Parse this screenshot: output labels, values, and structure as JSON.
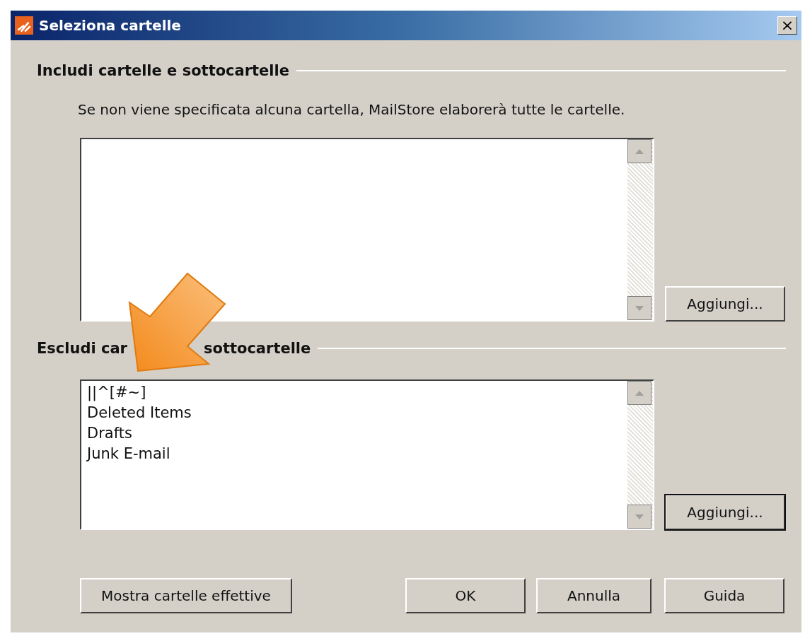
{
  "window": {
    "title": "Seleziona cartelle",
    "close": "×"
  },
  "include": {
    "heading": "Includi cartelle e sottocartelle",
    "note": "Se non viene specificata alcuna cartella, MailStore elaborerà tutte le cartelle.",
    "button": {
      "label": "Aggiungi...",
      "default": false
    }
  },
  "exclude": {
    "heading_parts": [
      "Escludi car",
      "sottocartelle"
    ],
    "items": [
      "||^[#~]",
      "Deleted Items",
      "Drafts",
      "Junk E-mail"
    ],
    "button": {
      "label": "Aggiungi...",
      "default": true
    }
  },
  "footer_buttons": [
    {
      "label": "Mostra cartelle effettive",
      "default": false
    },
    {
      "label": "OK",
      "default": false
    },
    {
      "label": "Annulla",
      "default": false
    },
    {
      "label": "Guida",
      "default": false
    }
  ]
}
